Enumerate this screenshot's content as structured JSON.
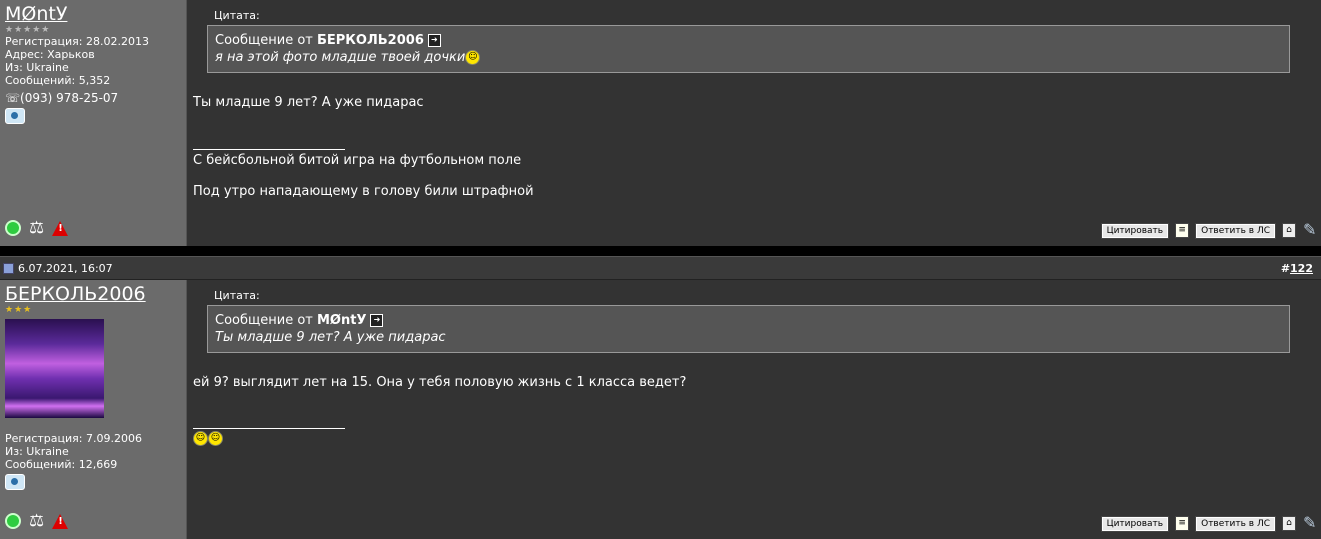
{
  "posts": [
    {
      "user": {
        "name": "MØntУ",
        "stars": "★★★★★",
        "registration": "Регистрация: 28.02.2013",
        "address": "Адрес: Харьков",
        "from": "Из: Ukraine",
        "messages": "Сообщений: 5,352",
        "phone": "☏(093) 978-25-07"
      },
      "quote": {
        "label": "Цитата:",
        "prefix": "Сообщение от ",
        "author": "БЕРКОЛЬ2006",
        "text": "я на этой фото младше твоей дочки"
      },
      "message": "Ты младше 9 лет? А уже пидарас",
      "signature": [
        "С бейсбольной битой игра на футбольном поле",
        "Под утро нападающему в голову били штрафной"
      ],
      "buttons": {
        "quote": "Цитировать",
        "reply_pm": "Ответить в ЛС"
      }
    },
    {
      "header": {
        "date": "6.07.2021, 16:07",
        "hash": "#",
        "number": "122"
      },
      "user": {
        "name": "БЕРКОЛЬ2006",
        "stars": "★★★",
        "registration": "Регистрация: 7.09.2006",
        "from": "Из: Ukraine",
        "messages": "Сообщений: 12,669"
      },
      "quote": {
        "label": "Цитата:",
        "prefix": "Сообщение от ",
        "author": "MØntУ",
        "text": "Ты младше 9 лет? А уже пидарас"
      },
      "message": "ей 9? выглядит лет на 15. Она у тебя половую жизнь с 1 класса ведет?",
      "buttons": {
        "quote": "Цитировать",
        "reply_pm": "Ответить в ЛС"
      }
    }
  ],
  "icons": {
    "goto": "arrow-goto-icon",
    "smile": "smile-icon",
    "online": "online-status-icon",
    "scales": "reputation-scales-icon",
    "warn": "report-warning-icon"
  }
}
